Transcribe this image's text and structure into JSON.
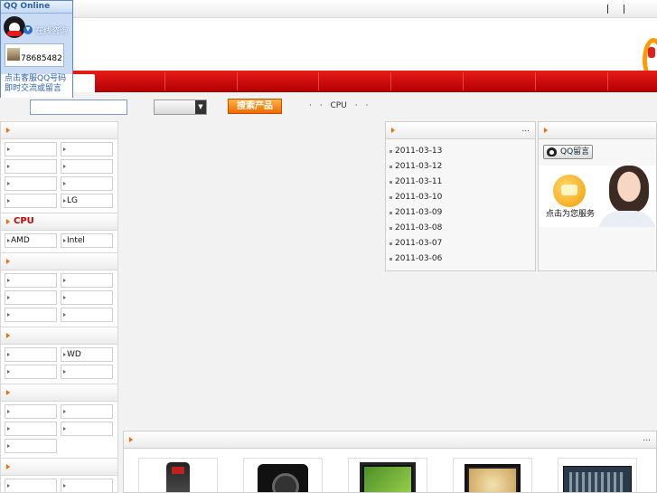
{
  "qq_widget": {
    "title": "QQ Online",
    "consult_label": "在线咨询",
    "qq_number": "78685482",
    "tip_line1": "点击客服QQ号码",
    "tip_line2": "即时交流或留言"
  },
  "search": {
    "input_value": "",
    "select_value": "",
    "button_label": "搜索产品",
    "hot_words": [
      "·",
      "·",
      "CPU",
      "·",
      "·"
    ]
  },
  "sidebar": {
    "sections": [
      {
        "title": "",
        "rows": [
          [
            "",
            ""
          ],
          [
            "",
            ""
          ],
          [
            "",
            ""
          ],
          [
            "",
            "LG"
          ]
        ]
      },
      {
        "title": "CPU",
        "rows": [
          [
            "AMD",
            "Intel"
          ]
        ]
      },
      {
        "title": "",
        "rows": [
          [
            "",
            ""
          ],
          [
            "",
            ""
          ],
          [
            "",
            ""
          ]
        ]
      },
      {
        "title": "",
        "rows": [
          [
            "",
            "WD"
          ],
          [
            "",
            ""
          ]
        ]
      },
      {
        "title": "",
        "rows": [
          [
            "",
            ""
          ],
          [
            "",
            ""
          ],
          [
            ""
          ]
        ]
      },
      {
        "title": "",
        "rows": [
          [
            "",
            ""
          ],
          [
            "",
            ""
          ]
        ]
      }
    ]
  },
  "news": {
    "more_label": "...",
    "items": [
      "2011-03-13",
      "2011-03-12",
      "2011-03-11",
      "2011-03-10",
      "2011-03-09",
      "2011-03-08",
      "2011-03-07",
      "2011-03-06"
    ]
  },
  "service": {
    "qq_message_label": "QQ留言",
    "banner_text": "点击为您服务"
  },
  "products": {
    "more_label": "...",
    "items": [
      {
        "icon": "mobile-phone"
      },
      {
        "icon": "dslr-camera"
      },
      {
        "icon": "lcd-monitor"
      },
      {
        "icon": "lcd-monitor-photo"
      },
      {
        "icon": "motherboard"
      }
    ]
  },
  "colors": {
    "nav_red": "#c80000",
    "accent_orange": "#ff6600",
    "qq_blue": "#2a5fb0"
  }
}
